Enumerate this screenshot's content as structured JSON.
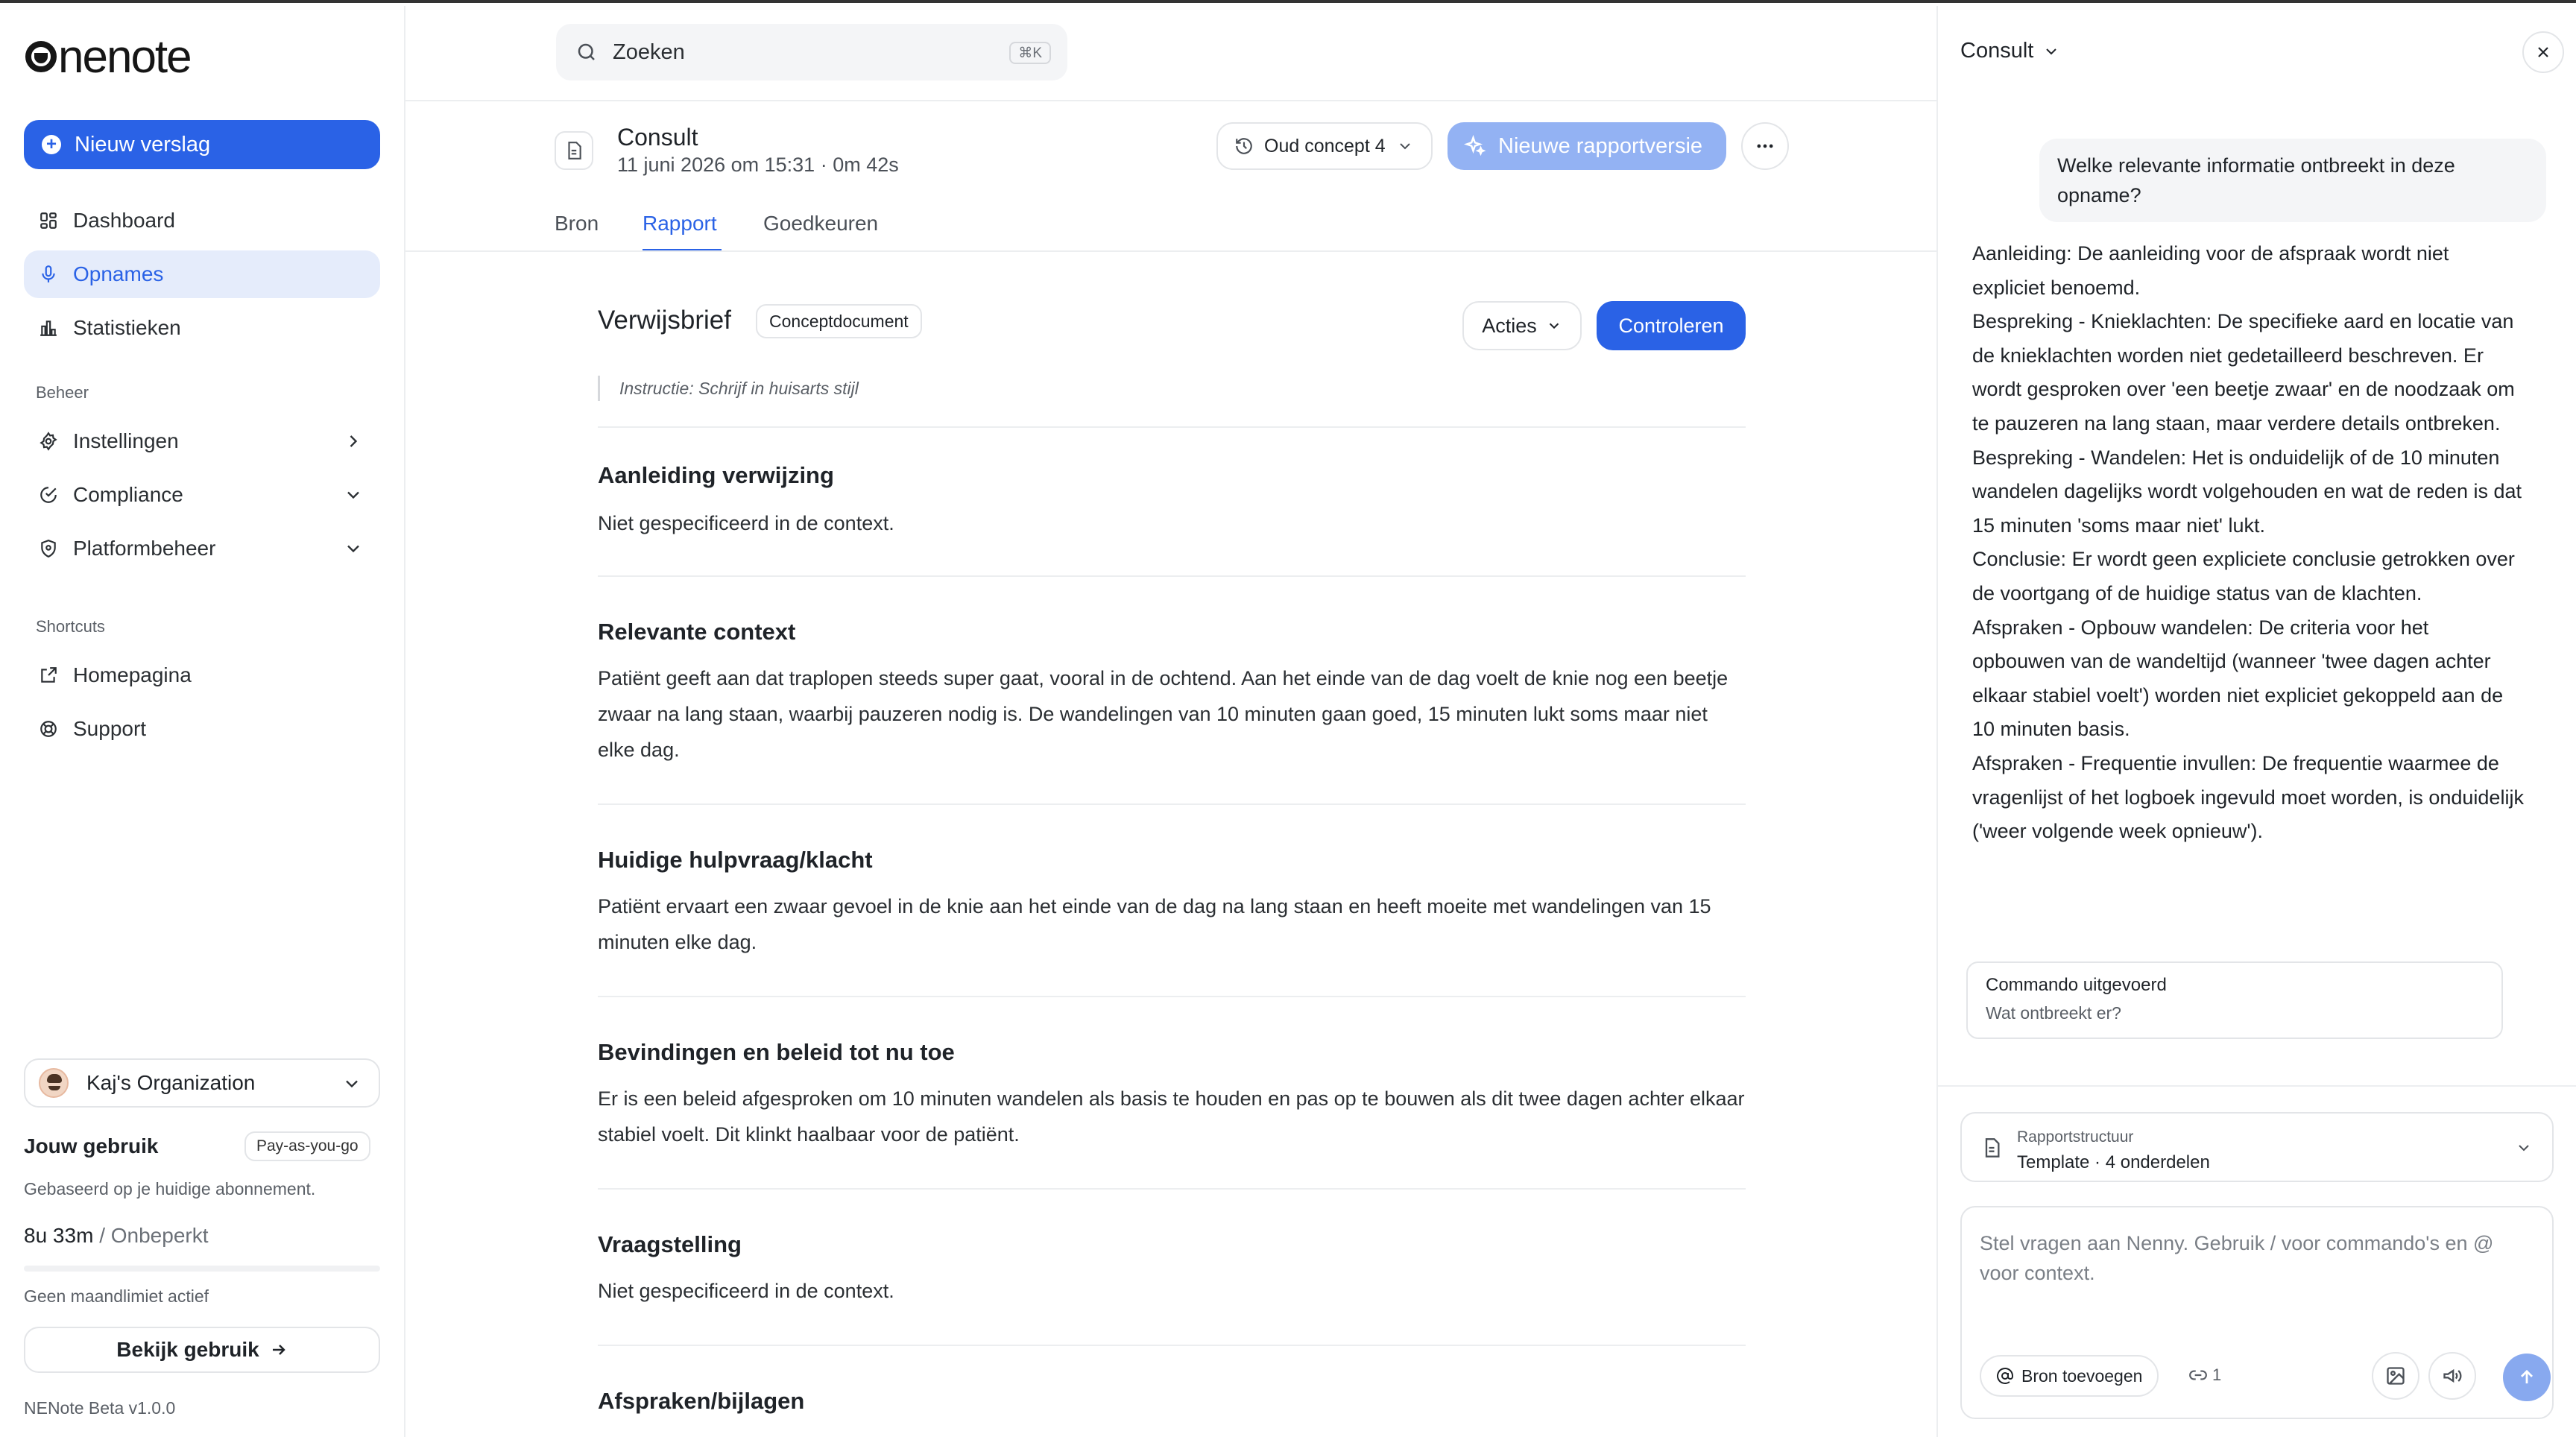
{
  "app": {
    "logo_text": "nenote"
  },
  "sidebar": {
    "new_report": "Nieuw verslag",
    "nav": [
      {
        "label": "Dashboard",
        "icon": "grid-icon"
      },
      {
        "label": "Opnames",
        "icon": "mic-icon"
      },
      {
        "label": "Statistieken",
        "icon": "bar-chart-icon"
      }
    ],
    "section_beheer": "Beheer",
    "beheer": [
      {
        "label": "Instellingen",
        "icon": "gear-icon"
      },
      {
        "label": "Compliance",
        "icon": "shield-check-icon"
      },
      {
        "label": "Platformbeheer",
        "icon": "shield-icon"
      }
    ],
    "section_shortcuts": "Shortcuts",
    "shortcuts": [
      {
        "label": "Homepagina",
        "icon": "external-link-icon"
      },
      {
        "label": "Support",
        "icon": "lifebuoy-icon"
      }
    ],
    "org": "Kaj's Organization",
    "usage_title": "Jouw gebruik",
    "plan_badge": "Pay-as-you-go",
    "usage_sub": "Gebaseerd op je huidige abonnement.",
    "usage_value": "8u 33m",
    "usage_limit_text": "/ Onbeperkt",
    "usage_fraction": 0.0,
    "no_limit": "Geen maandlimiet actief",
    "view_usage": "Bekijk gebruik",
    "version": "NENote Beta v1.0.0"
  },
  "header": {
    "search_placeholder": "Zoeken",
    "search_shortcut": "⌘K",
    "doc_title": "Consult",
    "doc_meta": "11 juni 2026 om 15:31 · 0m 42s",
    "concept_button": "Oud concept 4",
    "new_version_button": "Nieuwe rapportversie",
    "tabs": [
      "Bron",
      "Rapport",
      "Goedkeuren"
    ]
  },
  "report": {
    "title": "Verwijsbrief",
    "badge": "Conceptdocument",
    "actions": "Acties",
    "check": "Controleren",
    "instruction": "Instructie: Schrijf in huisarts stijl",
    "sections": [
      {
        "heading": "Aanleiding verwijzing",
        "text": "Niet gespecificeerd in de context."
      },
      {
        "heading": "Relevante context",
        "text": "Patiënt geeft aan dat traplopen steeds super gaat, vooral in de ochtend. Aan het einde van de dag voelt de knie nog een beetje zwaar na lang staan, waarbij pauzeren nodig is. De wandelingen van 10 minuten gaan goed, 15 minuten lukt soms maar niet elke dag."
      },
      {
        "heading": "Huidige hulpvraag/klacht",
        "text": "Patiënt ervaart een zwaar gevoel in de knie aan het einde van de dag na lang staan en heeft moeite met wandelingen van 15 minuten elke dag."
      },
      {
        "heading": "Bevindingen en beleid tot nu toe",
        "text": "Er is een beleid afgesproken om 10 minuten wandelen als basis te houden en pas op te bouwen als dit twee dagen achter elkaar stabiel voelt. Dit klinkt haalbaar voor de patiënt."
      },
      {
        "heading": "Vraagstelling",
        "text": "Niet gespecificeerd in de context."
      },
      {
        "heading": "Afspraken/bijlagen",
        "text": ""
      }
    ]
  },
  "panel": {
    "title": "Consult",
    "question": "Welke relevante informatie ontbreekt in deze opname?",
    "answer": [
      "Aanleiding: De aanleiding voor de afspraak wordt niet expliciet benoemd.",
      "Bespreking - Knieklachten: De specifieke aard en locatie van de knieklachten worden niet gedetailleerd beschreven. Er wordt gesproken over 'een beetje zwaar' en de noodzaak om te pauzeren na lang staan, maar verdere details ontbreken.",
      "Bespreking - Wandelen: Het is onduidelijk of de 10 minuten wandelen dagelijks wordt volgehouden en wat de reden is dat 15 minuten 'soms maar niet' lukt.",
      "Conclusie: Er wordt geen expliciete conclusie getrokken over de voortgang of de huidige status van de klachten.",
      "Afspraken - Opbouw wandelen: De criteria voor het opbouwen van de wandeltijd (wanneer 'twee dagen achter elkaar stabiel voelt') worden niet expliciet gekoppeld aan de 10 minuten basis.",
      "Afspraken - Frequentie invullen: De frequentie waarmee de vragenlijst of het logboek ingevuld moet worden, is onduidelijk ('weer volgende week opnieuw')."
    ],
    "cmd_title": "Commando uitgevoerd",
    "cmd_sub": "Wat ontbreekt er?",
    "struct_label": "Rapportstructuur",
    "struct_value": "Template · 4 onderdelen",
    "composer_placeholder": "Stel vragen aan Nenny. Gebruik / voor commando's en @ voor context.",
    "add_source": "Bron toevoegen",
    "link_count": "1"
  },
  "colors": {
    "accent": "#2a62e6",
    "accent_light": "#93b2f3",
    "active_bg": "#e5ecfb"
  }
}
